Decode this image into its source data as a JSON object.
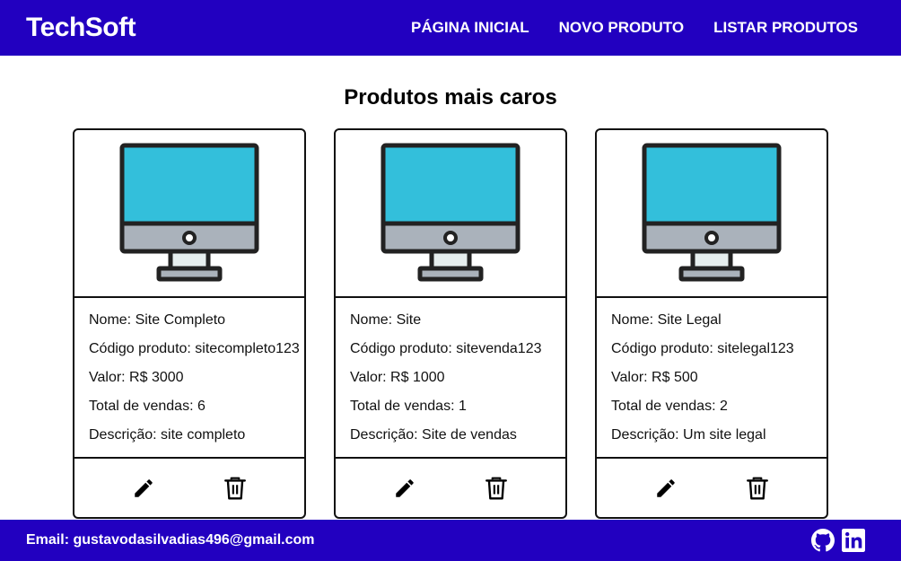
{
  "header": {
    "brand": "TechSoft",
    "nav": [
      "PÁGINA INICIAL",
      "NOVO PRODUTO",
      "LISTAR PRODUTOS"
    ]
  },
  "main": {
    "title": "Produtos mais caros",
    "products": [
      {
        "nome": "Nome: Site Completo",
        "codigo": "Código produto: sitecompleto123",
        "valor": "Valor: R$ 3000",
        "vendas": "Total de vendas: 6",
        "descricao": "Descrição: site completo"
      },
      {
        "nome": "Nome: Site",
        "codigo": "Código produto: sitevenda123",
        "valor": "Valor: R$ 1000",
        "vendas": "Total de vendas: 1",
        "descricao": "Descrição: Site de vendas"
      },
      {
        "nome": "Nome: Site Legal",
        "codigo": "Código produto: sitelegal123",
        "valor": "Valor: R$ 500",
        "vendas": "Total de vendas: 2",
        "descricao": "Descrição: Um site legal"
      }
    ]
  },
  "footer": {
    "email": "Email: gustavodasilvadias496@gmail.com",
    "icons": [
      "github-icon",
      "linkedin-icon"
    ]
  },
  "colors": {
    "brand_blue": "#2200c0",
    "screen": "#33bfdb",
    "monitor_base": "#aab2bb"
  }
}
